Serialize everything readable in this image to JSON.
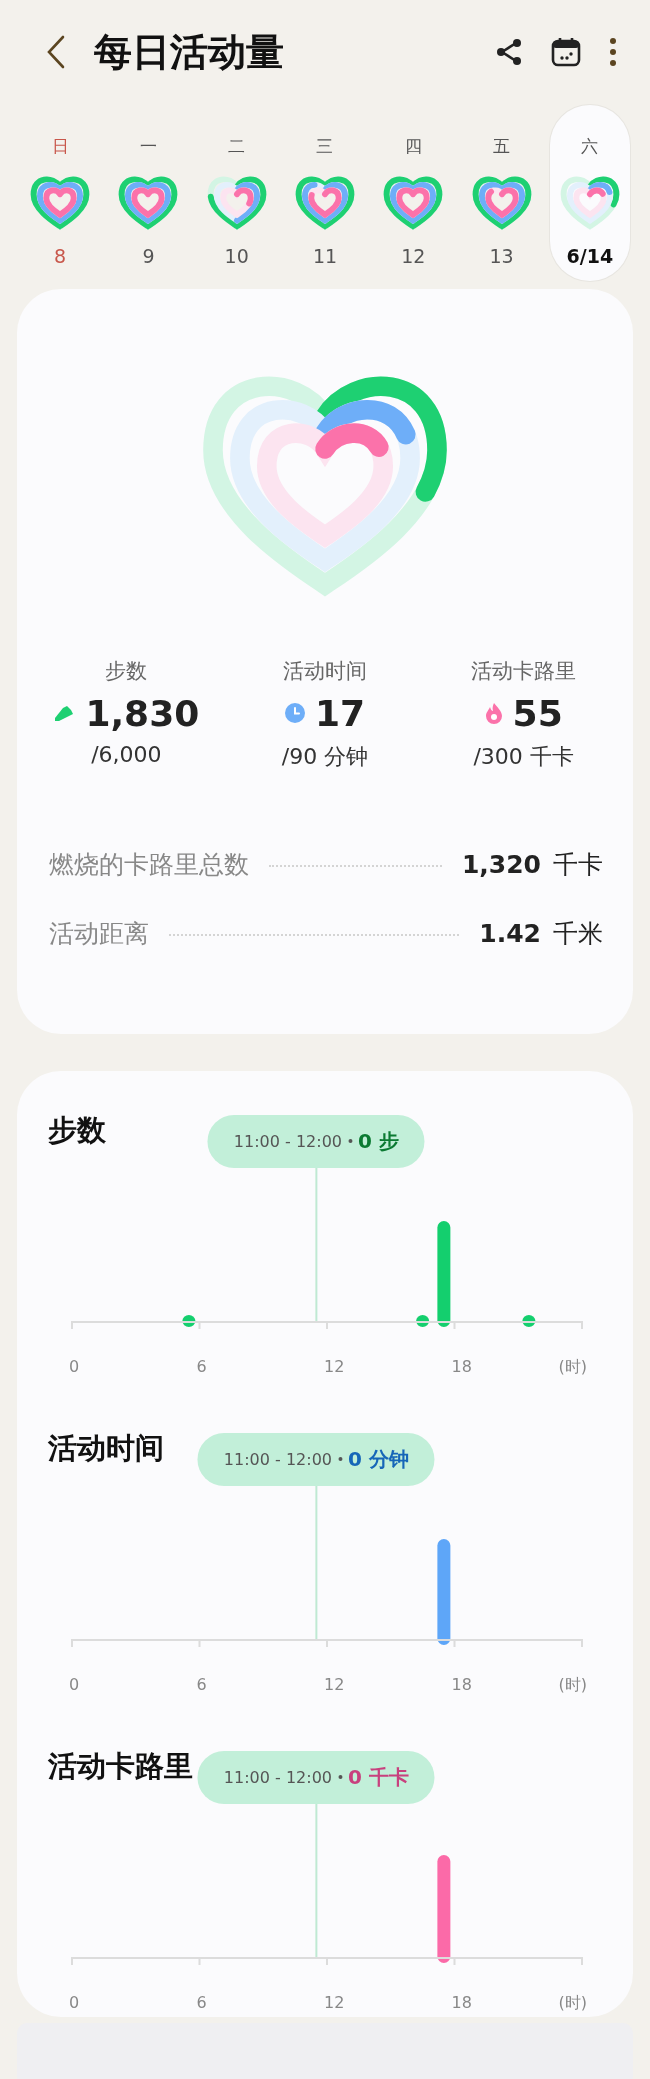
{
  "header": {
    "title": "每日活动量"
  },
  "week": [
    {
      "weekday": "日",
      "date": "8",
      "sunday": true,
      "selected": false
    },
    {
      "weekday": "一",
      "date": "9",
      "sunday": false,
      "selected": false
    },
    {
      "weekday": "二",
      "date": "10",
      "sunday": false,
      "selected": false
    },
    {
      "weekday": "三",
      "date": "11",
      "sunday": false,
      "selected": false
    },
    {
      "weekday": "四",
      "date": "12",
      "sunday": false,
      "selected": false
    },
    {
      "weekday": "五",
      "date": "13",
      "sunday": false,
      "selected": false
    },
    {
      "weekday": "六",
      "date": "6/14",
      "sunday": false,
      "selected": true
    }
  ],
  "stats": [
    {
      "kind": "steps",
      "label": "步数",
      "value": "1,830",
      "goal": "/6,000",
      "color": "#1ed072"
    },
    {
      "kind": "time",
      "label": "活动时间",
      "value": "17",
      "goal": "/90 分钟",
      "color": "#6eaef8"
    },
    {
      "kind": "calories",
      "label": "活动卡路里",
      "value": "55",
      "goal": "/300 千卡",
      "color": "#fb72aa"
    }
  ],
  "totals": [
    {
      "label": "燃烧的卡路里总数",
      "value": "1,320",
      "unit": "千卡"
    },
    {
      "label": "活动距离",
      "value": "1.42",
      "unit": "千米"
    }
  ],
  "charts": [
    {
      "kind": "steps",
      "title": "步数",
      "color": "#14cf6e",
      "tooltip": {
        "range": "11:00 - 12:00",
        "value": "0 步"
      },
      "xticks": [
        "0",
        "6",
        "12",
        "18"
      ],
      "unit": "(时)"
    },
    {
      "kind": "time",
      "title": "活动时间",
      "color": "#5ea6f8",
      "tooltip": {
        "range": "11:00 - 12:00",
        "value": "0 分钟"
      },
      "xticks": [
        "0",
        "6",
        "12",
        "18"
      ],
      "unit": "(时)"
    },
    {
      "kind": "calories",
      "title": "活动卡路里",
      "color": "#fb6aa8",
      "tooltip": {
        "range": "11:00 - 12:00",
        "value": "0 千卡"
      },
      "xticks": [
        "0",
        "6",
        "12",
        "18"
      ],
      "unit": "(时)"
    }
  ]
}
